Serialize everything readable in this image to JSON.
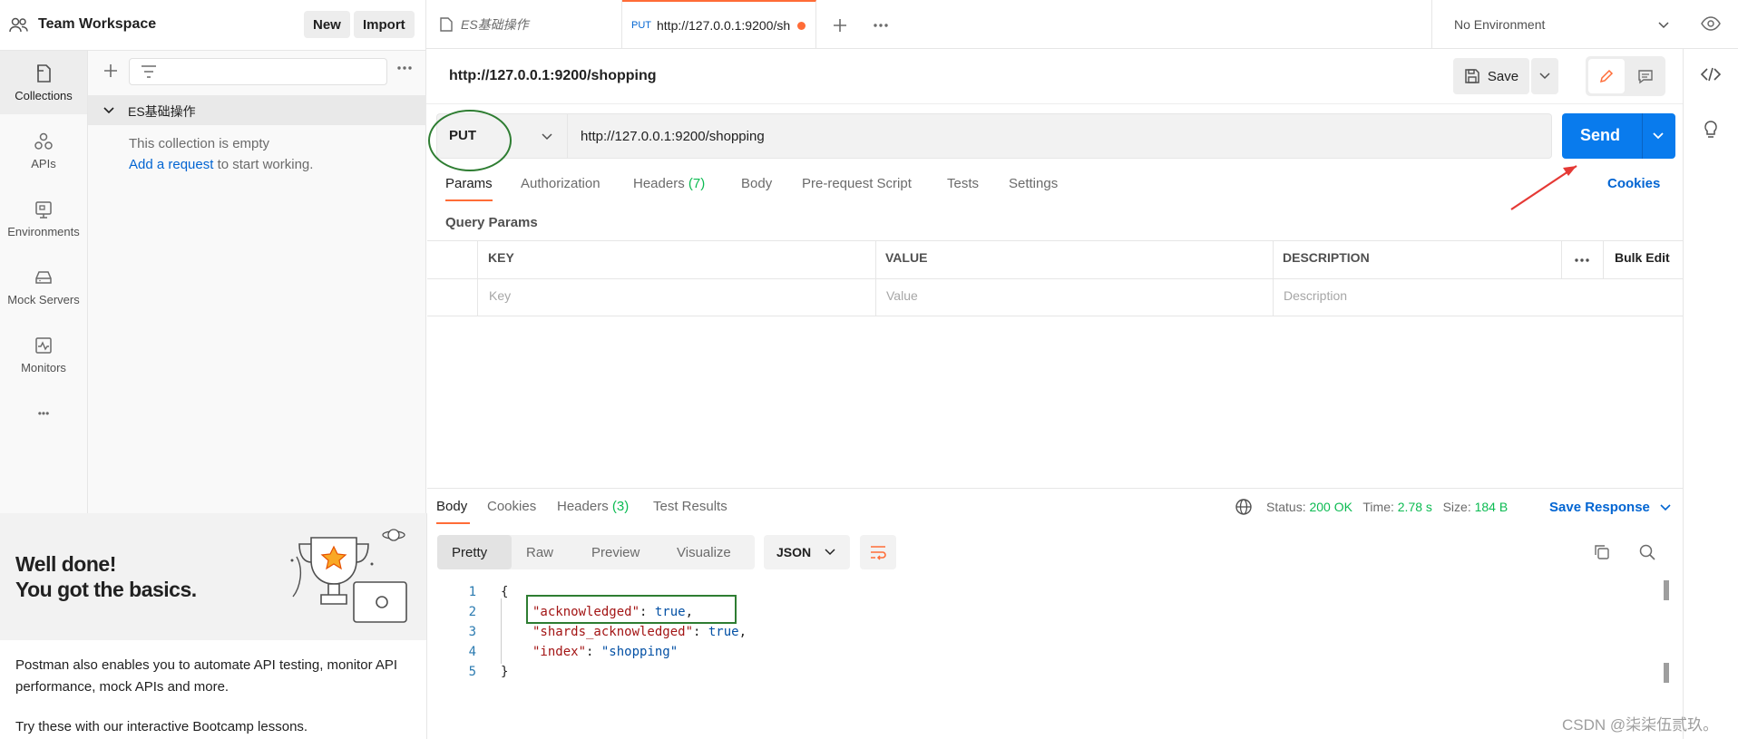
{
  "workspace": {
    "title": "Team Workspace",
    "new_label": "New",
    "import_label": "Import"
  },
  "rail": [
    {
      "label": "Collections",
      "icon": "collections-icon"
    },
    {
      "label": "APIs",
      "icon": "apis-icon"
    },
    {
      "label": "Environments",
      "icon": "environments-icon"
    },
    {
      "label": "Mock Servers",
      "icon": "mock-servers-icon"
    },
    {
      "label": "Monitors",
      "icon": "monitors-icon"
    },
    {
      "label": "•••",
      "icon": "more-icon"
    }
  ],
  "collection": {
    "name": "ES基础操作",
    "empty_text": "This collection is empty",
    "add_link": "Add a request",
    "add_suffix": " to start working."
  },
  "promo": {
    "line1": "Well done!",
    "line2": "You got the basics.",
    "para1": "Postman also enables you to automate API testing, monitor API performance, mock APIs and more.",
    "para2": "Try these with our interactive Bootcamp lessons."
  },
  "tabs": [
    {
      "label": "ES基础操作",
      "type": "collection"
    },
    {
      "method": "PUT",
      "label": "http://127.0.0.1:9200/sh"
    }
  ],
  "environment": {
    "selected": "No Environment"
  },
  "request": {
    "title": "http://127.0.0.1:9200/shopping",
    "save_label": "Save",
    "method": "PUT",
    "url": "http://127.0.0.1:9200/shopping",
    "send_label": "Send",
    "cookies_label": "Cookies",
    "tabs": [
      "Params",
      "Authorization",
      "Headers",
      "Body",
      "Pre-request Script",
      "Tests",
      "Settings"
    ],
    "headers_count": "(7)",
    "query_params_label": "Query Params",
    "table": {
      "headers": [
        "KEY",
        "VALUE",
        "DESCRIPTION"
      ],
      "placeholders": [
        "Key",
        "Value",
        "Description"
      ],
      "bulk_edit": "Bulk Edit"
    }
  },
  "response": {
    "tabs": [
      "Body",
      "Cookies",
      "Headers",
      "Test Results"
    ],
    "headers_count": "(3)",
    "status_label": "Status:",
    "status_value": "200 OK",
    "time_label": "Time:",
    "time_value": "2.78 s",
    "size_label": "Size:",
    "size_value": "184 B",
    "save_response": "Save Response",
    "views": [
      "Pretty",
      "Raw",
      "Preview",
      "Visualize"
    ],
    "format": "JSON",
    "line_numbers": [
      "1",
      "2",
      "3",
      "4",
      "5"
    ],
    "lines": [
      {
        "text": "{"
      },
      {
        "key": "\"acknowledged\"",
        "value": "true",
        "trail": ","
      },
      {
        "key": "\"shards_acknowledged\"",
        "value": "true",
        "trail": ","
      },
      {
        "key": "\"index\"",
        "value": "\"shopping\"",
        "trail": ""
      },
      {
        "text": "}"
      }
    ]
  },
  "watermark": "CSDN @柒柒伍贰玖。",
  "colors": {
    "accent": "#097bed",
    "annotation_green": "#2e7d32",
    "annotation_red": "#e53935",
    "tab_indicator": "#ff6c37"
  }
}
